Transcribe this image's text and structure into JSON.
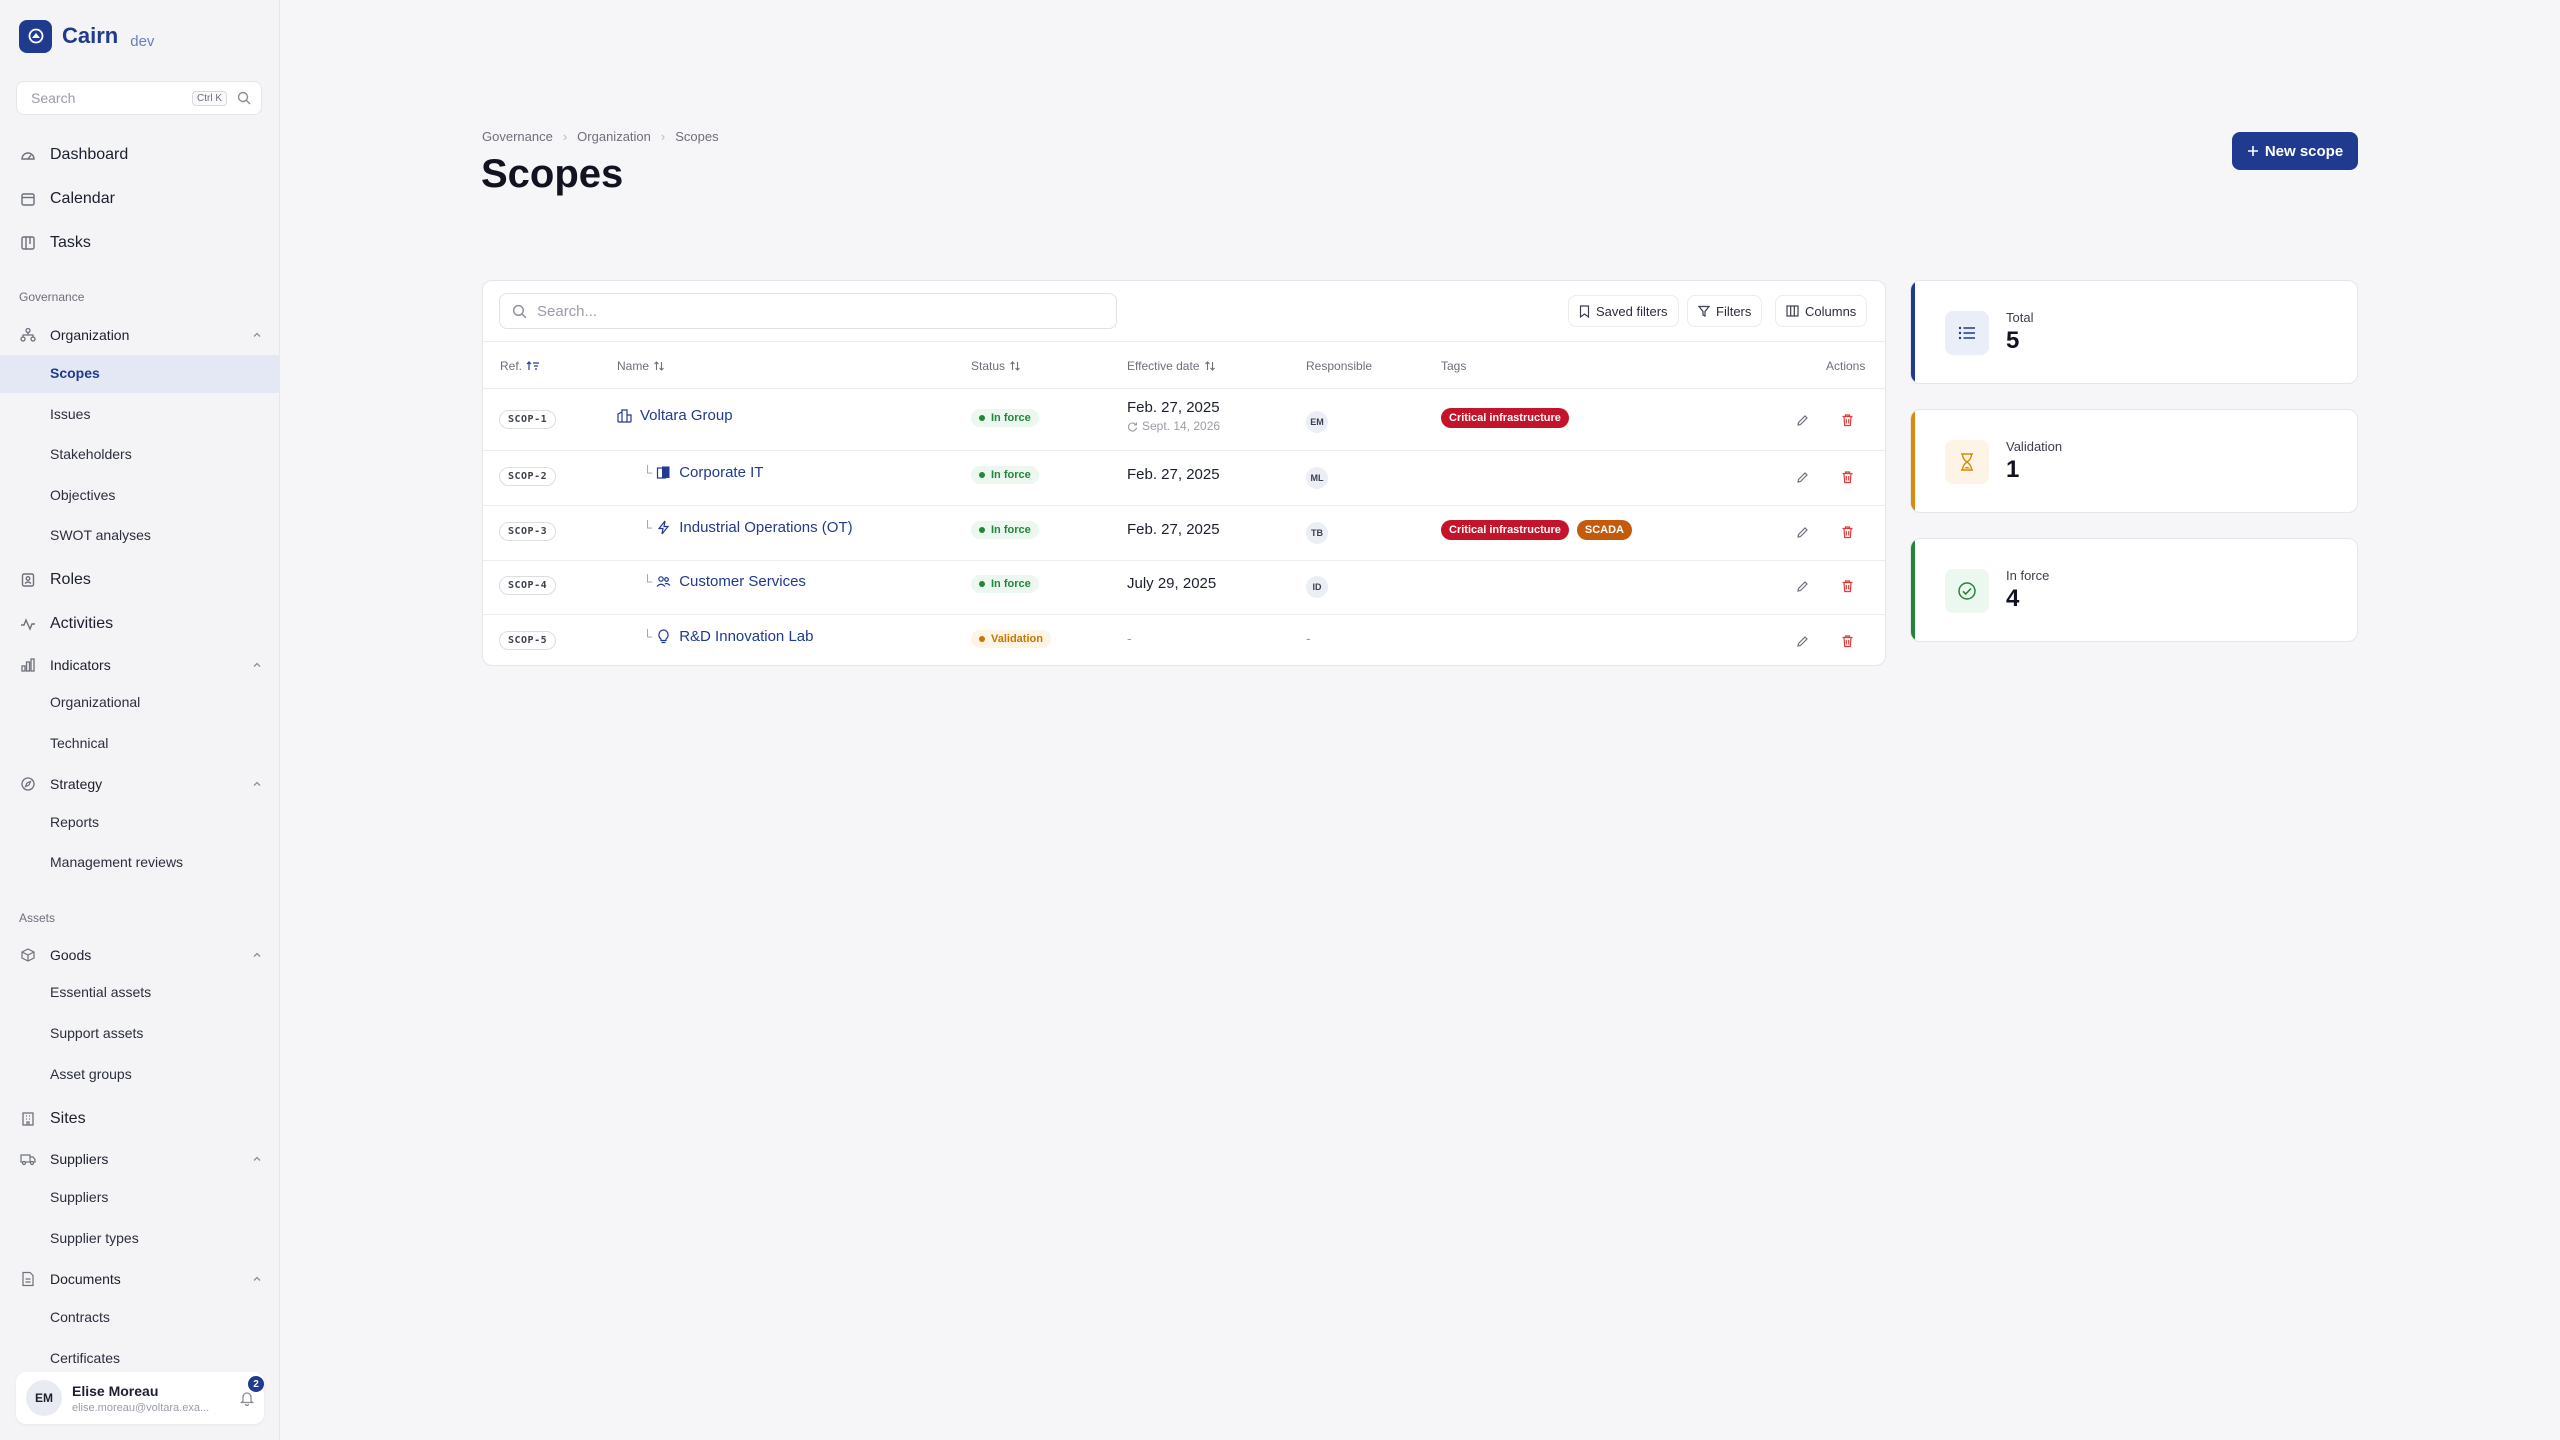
{
  "app": {
    "name": "Cairn",
    "env": "dev"
  },
  "sidebar": {
    "search_placeholder": "Search",
    "search_shortcut": "Ctrl K",
    "top_items": [
      "Dashboard",
      "Calendar",
      "Tasks"
    ],
    "sections": {
      "governance": "Governance",
      "assets": "Assets"
    },
    "organization": {
      "label": "Organization",
      "items": [
        "Scopes",
        "Issues",
        "Stakeholders",
        "Objectives",
        "SWOT analyses"
      ]
    },
    "roles": "Roles",
    "activities": "Activities",
    "indicators": {
      "label": "Indicators",
      "items": [
        "Organizational",
        "Technical"
      ]
    },
    "strategy": {
      "label": "Strategy",
      "items": [
        "Reports",
        "Management reviews"
      ]
    },
    "goods": {
      "label": "Goods",
      "items": [
        "Essential assets",
        "Support assets",
        "Asset groups"
      ]
    },
    "sites": "Sites",
    "suppliers": {
      "label": "Suppliers",
      "items": [
        "Suppliers",
        "Supplier types"
      ]
    },
    "documents": {
      "label": "Documents",
      "items": [
        "Contracts",
        "Certificates"
      ]
    },
    "user": {
      "initials": "EM",
      "name": "Elise Moreau",
      "email": "elise.moreau@voltara.exa...",
      "notifications": "2"
    }
  },
  "breadcrumb": [
    "Governance",
    "Organization",
    "Scopes"
  ],
  "page": {
    "title": "Scopes",
    "new_button": "New scope"
  },
  "table": {
    "search_placeholder": "Search...",
    "toolbar": {
      "saved_filters": "Saved filters",
      "filters": "Filters",
      "columns": "Columns"
    },
    "headers": {
      "ref": "Ref.",
      "name": "Name",
      "status": "Status",
      "effective_date": "Effective date",
      "responsible": "Responsible",
      "tags": "Tags",
      "actions": "Actions"
    },
    "rows": [
      {
        "ref": "SCOP-1",
        "name": "Voltara Group",
        "status": "In force",
        "date": "Feb. 27, 2025",
        "date_sub": "Sept. 14, 2026",
        "responsible": "EM",
        "tags": [
          "Critical infrastructure"
        ]
      },
      {
        "ref": "SCOP-2",
        "name": "Corporate IT",
        "status": "In force",
        "date": "Feb. 27, 2025",
        "responsible": "ML",
        "tags": []
      },
      {
        "ref": "SCOP-3",
        "name": "Industrial Operations (OT)",
        "status": "In force",
        "date": "Feb. 27, 2025",
        "responsible": "TB",
        "tags": [
          "Critical infrastructure",
          "SCADA"
        ]
      },
      {
        "ref": "SCOP-4",
        "name": "Customer Services",
        "status": "In force",
        "date": "July 29, 2025",
        "responsible": "ID",
        "tags": []
      },
      {
        "ref": "SCOP-5",
        "name": "R&D Innovation Lab",
        "status": "Validation",
        "date": "-",
        "responsible": "-",
        "tags": []
      }
    ]
  },
  "stats": [
    {
      "label": "Total",
      "value": "5",
      "color": "#1f3a8f"
    },
    {
      "label": "Validation",
      "value": "1",
      "color": "#d98a0b"
    },
    {
      "label": "In force",
      "value": "4",
      "color": "#22863a"
    }
  ]
}
